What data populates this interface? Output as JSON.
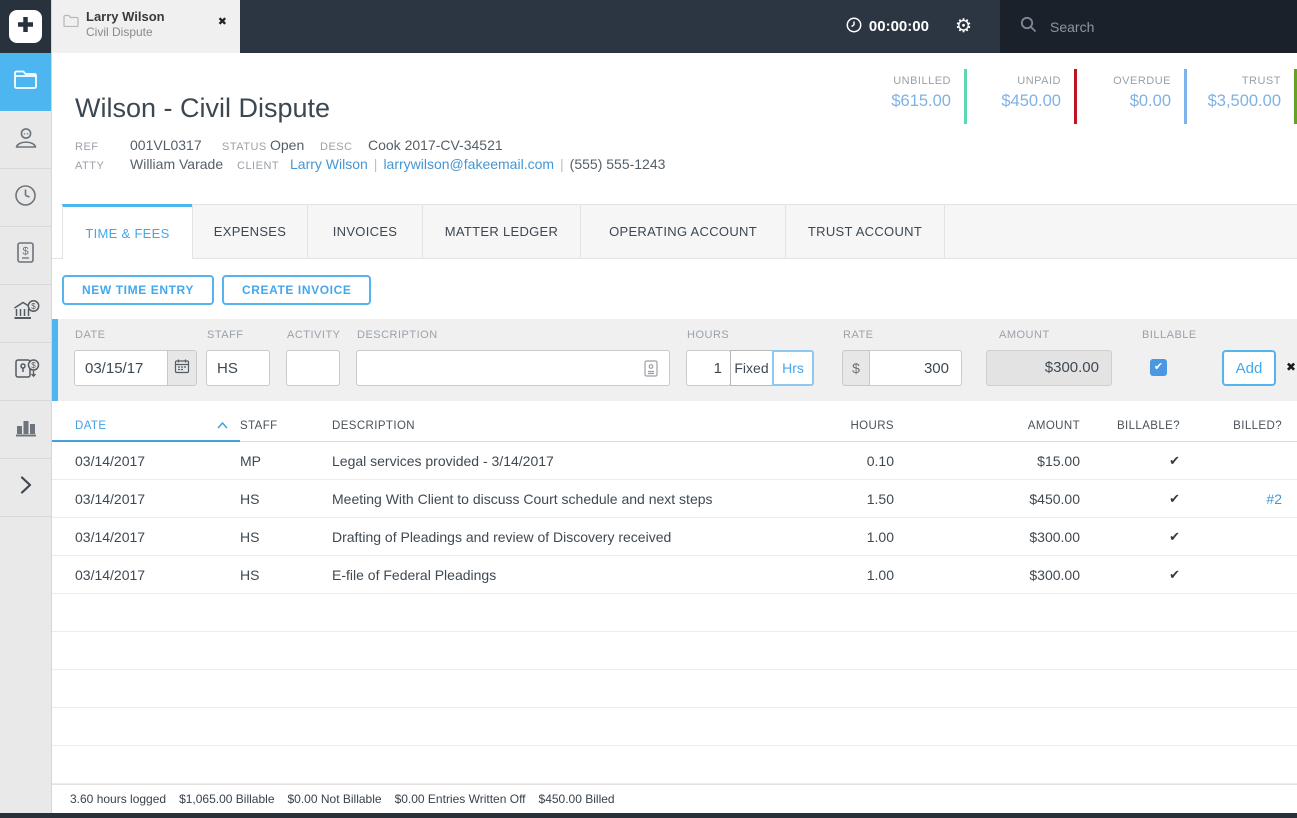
{
  "icons": {
    "close": "✖",
    "check": "✔",
    "gear": "⚙"
  },
  "app": {
    "timer": "00:00:00",
    "search_placeholder": "Search",
    "doc_tab": {
      "title": "Larry Wilson",
      "subtitle": "Civil Dispute"
    }
  },
  "sidebar": {
    "items": [
      {
        "icon": "matters-folder-icon",
        "active": true
      },
      {
        "icon": "contacts-icon",
        "active": false
      },
      {
        "icon": "time-clock-icon",
        "active": false
      },
      {
        "icon": "billing-invoice-icon",
        "active": false
      },
      {
        "icon": "operating-bank-icon",
        "active": false
      },
      {
        "icon": "trust-safe-icon",
        "active": false
      },
      {
        "icon": "reports-chart-icon",
        "active": false
      },
      {
        "icon": "expand-chevron-icon",
        "active": false
      }
    ]
  },
  "summary": {
    "blocks": [
      {
        "label": "UNBILLED",
        "value": "$615.00",
        "accent": "#5ed6b4"
      },
      {
        "label": "UNPAID",
        "value": "$450.00",
        "accent": "#bf1423"
      },
      {
        "label": "OVERDUE",
        "value": "$0.00",
        "accent": "#7db3ea"
      },
      {
        "label": "TRUST",
        "value": "$3,500.00",
        "accent": "#63a227"
      }
    ]
  },
  "matter": {
    "title": "Wilson - Civil Dispute",
    "ref_label": "REF",
    "ref": "001VL0317",
    "status_label": "STATUS",
    "status": "Open",
    "desc_label": "DESC",
    "desc": "Cook 2017-CV-34521",
    "atty_label": "ATTY",
    "atty": "William Varade",
    "client_label": "CLIENT",
    "client": "Larry Wilson",
    "separator": "|",
    "client_email": "larrywilson@fakeemail.com",
    "client_phone": "(555) 555-1243"
  },
  "tabs": [
    {
      "label": "TIME & FEES",
      "active": true
    },
    {
      "label": "EXPENSES",
      "active": false
    },
    {
      "label": "INVOICES",
      "active": false
    },
    {
      "label": "MATTER LEDGER",
      "active": false
    },
    {
      "label": "OPERATING ACCOUNT",
      "active": false
    },
    {
      "label": "TRUST ACCOUNT",
      "active": false
    }
  ],
  "actions": {
    "new_time_entry": "NEW TIME ENTRY",
    "create_invoice": "CREATE INVOICE"
  },
  "entry_form": {
    "date_label": "DATE",
    "date_value": "03/15/17",
    "staff_label": "STAFF",
    "staff_value": "HS",
    "activity_label": "ACTIVITY",
    "activity_value": "",
    "description_label": "DESCRIPTION",
    "description_value": "",
    "hours_label": "HOURS",
    "hours_value": "1",
    "fixed_toggle": "Fixed",
    "hrs_toggle": "Hrs",
    "rate_label": "RATE",
    "rate_prefix": "$",
    "rate_value": "300",
    "amount_label": "AMOUNT",
    "amount_value": "$300.00",
    "billable_label": "BILLABLE",
    "billable_checked": true,
    "add_button": "Add"
  },
  "table": {
    "headers": {
      "date": "DATE",
      "staff": "STAFF",
      "description": "DESCRIPTION",
      "hours": "HOURS",
      "amount": "AMOUNT",
      "billable": "BILLABLE?",
      "billed": "BILLED?"
    },
    "rows": [
      {
        "date": "03/14/2017",
        "staff": "MP",
        "description": "Legal services provided - 3/14/2017",
        "hours": "0.10",
        "amount": "$15.00",
        "billable": true,
        "billed": ""
      },
      {
        "date": "03/14/2017",
        "staff": "HS",
        "description": "Meeting With Client to discuss Court schedule and next steps",
        "hours": "1.50",
        "amount": "$450.00",
        "billable": true,
        "billed": "#2"
      },
      {
        "date": "03/14/2017",
        "staff": "HS",
        "description": "Drafting of Pleadings and review of Discovery received",
        "hours": "1.00",
        "amount": "$300.00",
        "billable": true,
        "billed": ""
      },
      {
        "date": "03/14/2017",
        "staff": "HS",
        "description": "E-file of Federal Pleadings",
        "hours": "1.00",
        "amount": "$300.00",
        "billable": true,
        "billed": ""
      }
    ]
  },
  "footer": {
    "stats": [
      "3.60 hours logged",
      "$1,065.00 Billable",
      "$0.00 Not Billable",
      "$0.00 Entries Written Off",
      "$450.00 Billed"
    ]
  }
}
